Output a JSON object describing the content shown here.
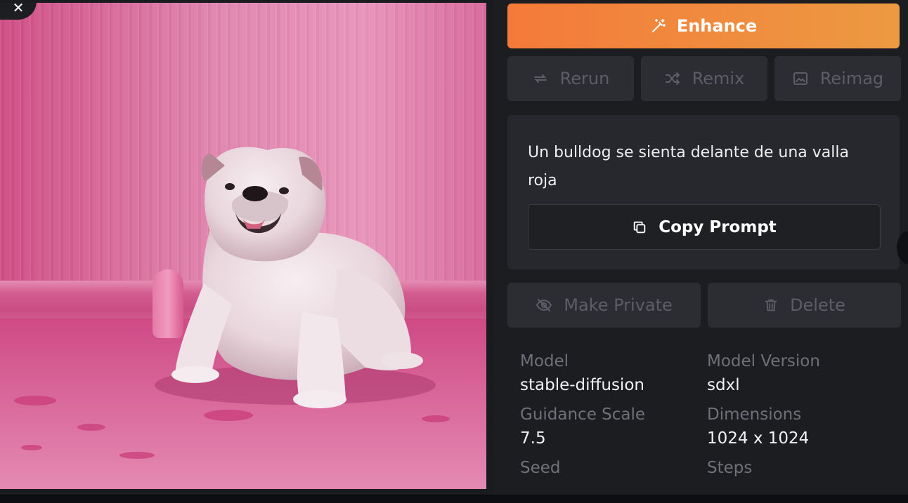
{
  "image": {
    "alt": "Un bulldog se sienta delante de una valla roja"
  },
  "close_button": {
    "icon": "close-icon",
    "glyph": "✕"
  },
  "actions": {
    "enhance_label": "Enhance",
    "rerun_label": "Rerun",
    "remix_label": "Remix",
    "reimagine_label": "Reimag",
    "make_private_label": "Make Private",
    "delete_label": "Delete"
  },
  "prompt": {
    "text": "Un bulldog se sienta delante de una valla roja",
    "copy_label": "Copy Prompt"
  },
  "metadata": {
    "model_label": "Model",
    "model_value": "stable-diffusion",
    "model_version_label": "Model Version",
    "model_version_value": "sdxl",
    "guidance_label": "Guidance Scale",
    "guidance_value": "7.5",
    "dimensions_label": "Dimensions",
    "dimensions_value": "1024 x 1024",
    "seed_label": "Seed",
    "steps_label": "Steps"
  },
  "colors": {
    "enhance_gradient_start": "#f47a3a",
    "enhance_gradient_end": "#ec9a42",
    "sidebar_bg": "#1c1d21",
    "card_bg": "#26282d"
  }
}
